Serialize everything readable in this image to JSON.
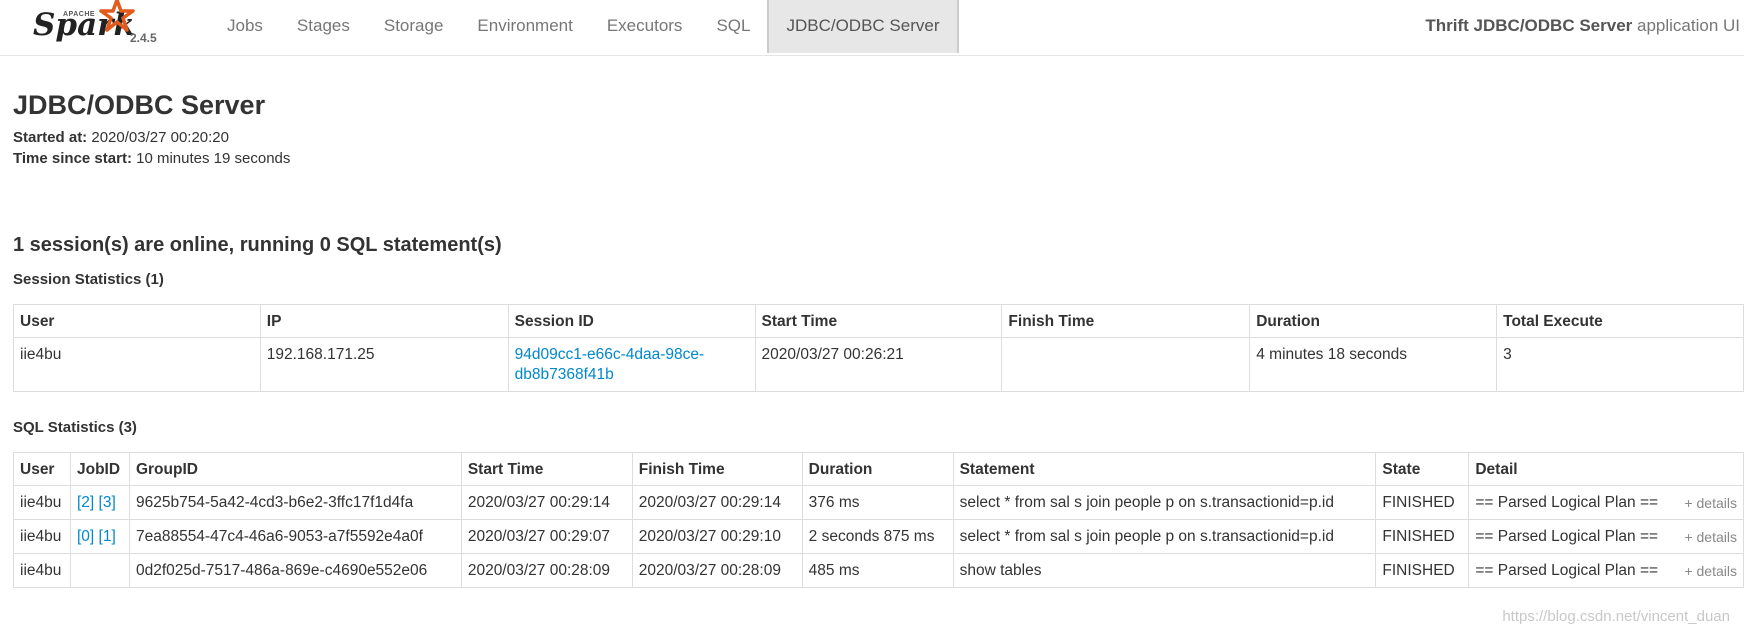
{
  "navbar": {
    "brand_apache": "APACHE",
    "brand_name": "Spark",
    "version": "2.4.5",
    "items": [
      {
        "label": "Jobs"
      },
      {
        "label": "Stages"
      },
      {
        "label": "Storage"
      },
      {
        "label": "Environment"
      },
      {
        "label": "Executors"
      },
      {
        "label": "SQL"
      },
      {
        "label": "JDBC/ODBC Server",
        "active": true
      }
    ],
    "app_name_bold": "Thrift JDBC/ODBC Server",
    "app_name_suffix": " application UI"
  },
  "page": {
    "title": "JDBC/ODBC Server",
    "started_at_label": "Started at:",
    "started_at_value": " 2020/03/27 00:20:20",
    "time_since_label": "Time since start:",
    "time_since_value": " 10 minutes 19 seconds",
    "summary": "1 session(s) are online, running 0 SQL statement(s)"
  },
  "session_stats": {
    "title": "Session Statistics (1)",
    "columns": [
      "User",
      "IP",
      "Session ID",
      "Start Time",
      "Finish Time",
      "Duration",
      "Total Execute"
    ],
    "row": {
      "user": "iie4bu",
      "ip": "192.168.171.25",
      "session_id_line1": "94d09cc1-e66c-4daa-98ce-",
      "session_id_line2": "db8b7368f41b",
      "start_time": "2020/03/27 00:26:21",
      "finish_time": "",
      "duration": "4 minutes 18 seconds",
      "total_execute": "3"
    }
  },
  "sql_stats": {
    "title": "SQL Statistics (3)",
    "columns": [
      "User",
      "JobID",
      "GroupID",
      "Start Time",
      "Finish Time",
      "Duration",
      "Statement",
      "State",
      "Detail"
    ],
    "rows": [
      {
        "user": "iie4bu",
        "job1": "[2]",
        "job2": "[3]",
        "group_id": "9625b754-5a42-4cd3-b6e2-3ffc17f1d4fa",
        "start": "2020/03/27 00:29:14",
        "finish": "2020/03/27 00:29:14",
        "duration": "376 ms",
        "statement": "select * from sal s join people p on s.transactionid=p.id",
        "state": "FINISHED",
        "detail": "== Parsed Logical Plan ==",
        "details_link": "+ details"
      },
      {
        "user": "iie4bu",
        "job1": "[0]",
        "job2": "[1]",
        "group_id": "7ea88554-47c4-46a6-9053-a7f5592e4a0f",
        "start": "2020/03/27 00:29:07",
        "finish": "2020/03/27 00:29:10",
        "duration": "2 seconds 875 ms",
        "statement": "select * from sal s join people p on s.transactionid=p.id",
        "state": "FINISHED",
        "detail": "== Parsed Logical Plan ==",
        "details_link": "+ details"
      },
      {
        "user": "iie4bu",
        "job1": "",
        "job2": "",
        "group_id": "0d2f025d-7517-486a-869e-c4690e552e06",
        "start": "2020/03/27 00:28:09",
        "finish": "2020/03/27 00:28:09",
        "duration": "485 ms",
        "statement": "show tables",
        "state": "FINISHED",
        "detail": "== Parsed Logical Plan ==",
        "details_link": "+ details"
      }
    ]
  },
  "watermark": "https://blog.csdn.net/vincent_duan",
  "colors": {
    "link": "#0088cc",
    "nav_active_bg": "#e7e7e7",
    "brand_orange": "#e25a1c"
  }
}
